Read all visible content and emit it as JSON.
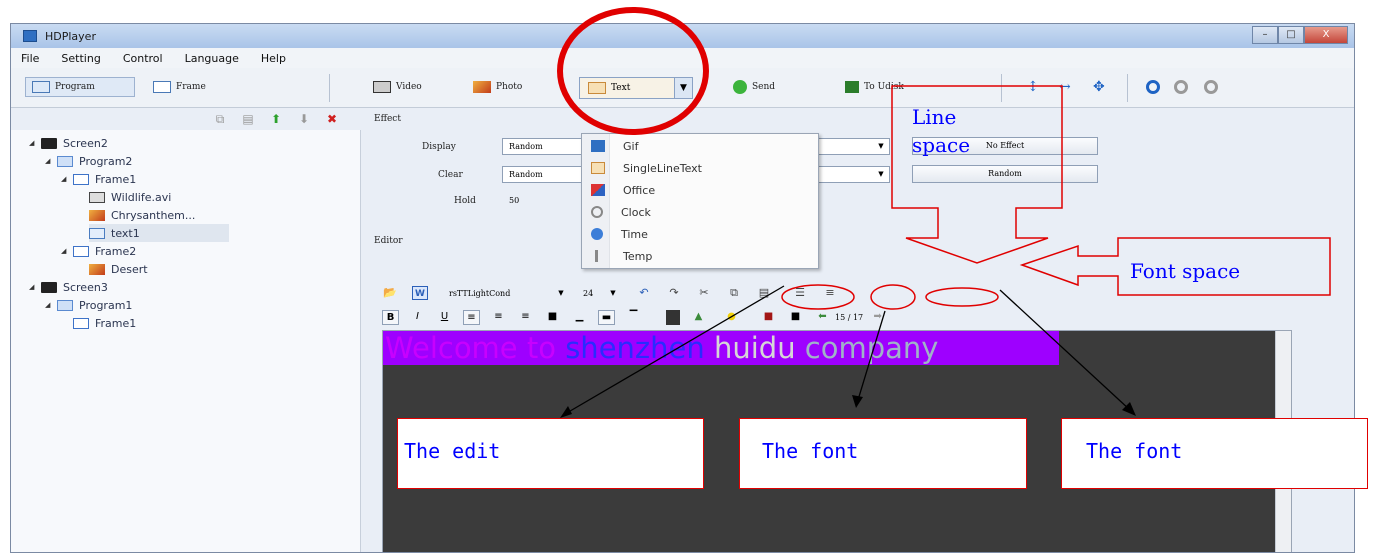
{
  "window": {
    "title": "HDPlayer",
    "controls": [
      "–",
      "□",
      "X"
    ]
  },
  "menubar": [
    "File",
    "Setting",
    "Control",
    "Language",
    "Help"
  ],
  "toolbar": {
    "program": "Program",
    "frame": "Frame",
    "video": "Video",
    "photo": "Photo",
    "text": "Text",
    "text_dropdown_arrow": "▼",
    "send": "Send",
    "to_udisk": "To Udisk"
  },
  "tree_toolbar_icons": [
    "copy-icon",
    "paste-icon",
    "move-up-icon",
    "move-down-icon",
    "delete-icon"
  ],
  "tree": [
    {
      "label": "Screen2",
      "icon": "screen-icon"
    },
    {
      "label": "Program2",
      "icon": "program-icon"
    },
    {
      "label": "Frame1",
      "icon": "frame-icon"
    },
    {
      "label": "Wildlife.avi",
      "icon": "video-icon"
    },
    {
      "label": "Chrysanthem...",
      "icon": "photo-icon"
    },
    {
      "label": "text1",
      "icon": "text-icon"
    },
    {
      "label": "Frame2",
      "icon": "frame-icon"
    },
    {
      "label": "Desert",
      "icon": "photo-icon"
    },
    {
      "label": "Screen3",
      "icon": "screen-icon"
    },
    {
      "label": "Program1",
      "icon": "program-icon"
    },
    {
      "label": "Frame1",
      "icon": "frame-icon"
    }
  ],
  "effect": {
    "section": "Effect",
    "display_label": "Display",
    "display_value": "Random",
    "clear_label": "Clear",
    "clear_value": "Random",
    "hold_label": "Hold",
    "hold_value": "50",
    "no_effect": "No Effect",
    "random_button": "Random"
  },
  "editor": {
    "section": "Editor",
    "font": "rsTTLightCond",
    "size": "24",
    "page_counter": "15 / 17",
    "content": [
      {
        "text": "Welcome to ",
        "color": "#c800ff"
      },
      {
        "text": "shenzhen ",
        "color": "#2a2bff"
      },
      {
        "text": "huidu ",
        "color": "#d6d6d6"
      },
      {
        "text": "company",
        "color": "#a0b2c8"
      }
    ],
    "highlight_color": "#9e00ff",
    "background_color": "#3b3b3b"
  },
  "text_menu": [
    "Gif",
    "SingleLineText",
    "Office",
    "Clock",
    "Time",
    "Temp"
  ],
  "annotations": {
    "line_space": "Line space",
    "font_space": "Font space",
    "the_edit": "The edit",
    "the_font_1": "The font",
    "the_font_2": "The font",
    "color": "#e00000",
    "text_color": "#0000ff"
  }
}
